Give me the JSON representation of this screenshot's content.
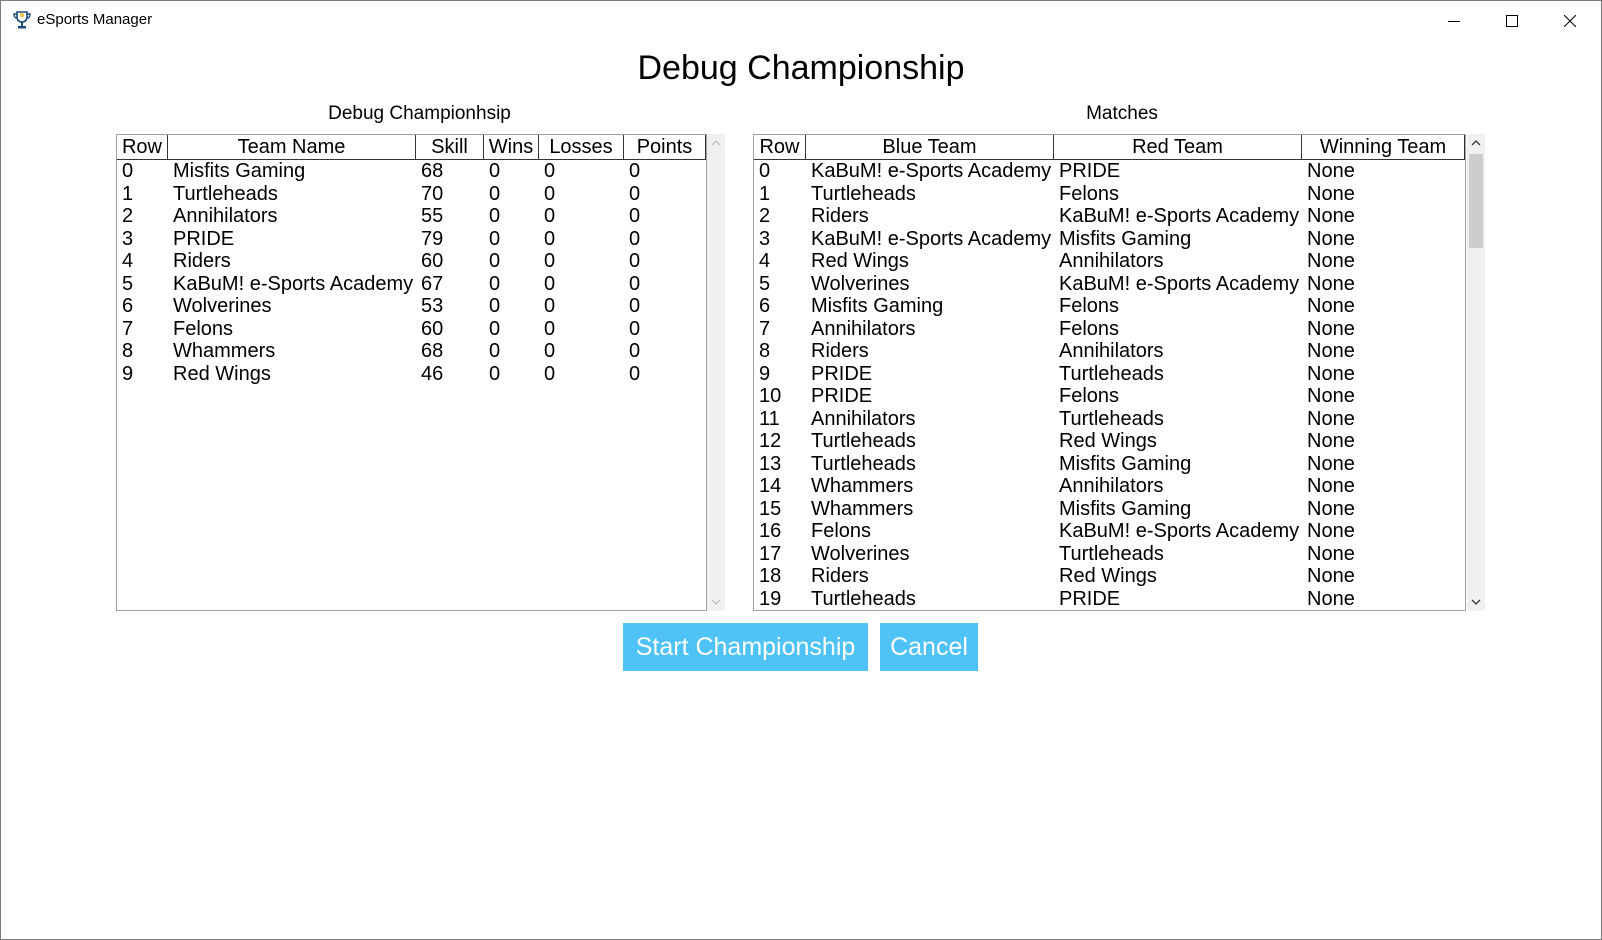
{
  "window": {
    "title": "eSports Manager",
    "icon": "trophy-icon"
  },
  "page": {
    "heading": "Debug Championship"
  },
  "standings": {
    "caption": "Debug Championhsip",
    "columns": [
      "Row",
      "Team Name",
      "Skill",
      "Wins",
      "Losses",
      "Points"
    ],
    "rows": [
      [
        "0",
        "Misfits Gaming",
        "68",
        "0",
        "0",
        "0"
      ],
      [
        "1",
        "Turtleheads",
        "70",
        "0",
        "0",
        "0"
      ],
      [
        "2",
        "Annihilators",
        "55",
        "0",
        "0",
        "0"
      ],
      [
        "3",
        "PRIDE",
        "79",
        "0",
        "0",
        "0"
      ],
      [
        "4",
        "Riders",
        "60",
        "0",
        "0",
        "0"
      ],
      [
        "5",
        "KaBuM! e-Sports Academy",
        "67",
        "0",
        "0",
        "0"
      ],
      [
        "6",
        "Wolverines",
        "53",
        "0",
        "0",
        "0"
      ],
      [
        "7",
        "Felons",
        "60",
        "0",
        "0",
        "0"
      ],
      [
        "8",
        "Whammers",
        "68",
        "0",
        "0",
        "0"
      ],
      [
        "9",
        "Red Wings",
        "46",
        "0",
        "0",
        "0"
      ]
    ]
  },
  "matches": {
    "caption": "Matches",
    "columns": [
      "Row",
      "Blue Team",
      "Red Team",
      "Winning Team"
    ],
    "rows": [
      [
        "0",
        "KaBuM! e-Sports Academy",
        "PRIDE",
        "None"
      ],
      [
        "1",
        "Turtleheads",
        "Felons",
        "None"
      ],
      [
        "2",
        "Riders",
        "KaBuM! e-Sports Academy",
        "None"
      ],
      [
        "3",
        "KaBuM! e-Sports Academy",
        "Misfits Gaming",
        "None"
      ],
      [
        "4",
        "Red Wings",
        "Annihilators",
        "None"
      ],
      [
        "5",
        "Wolverines",
        "KaBuM! e-Sports Academy",
        "None"
      ],
      [
        "6",
        "Misfits Gaming",
        "Felons",
        "None"
      ],
      [
        "7",
        "Annihilators",
        "Felons",
        "None"
      ],
      [
        "8",
        "Riders",
        "Annihilators",
        "None"
      ],
      [
        "9",
        "PRIDE",
        "Turtleheads",
        "None"
      ],
      [
        "10",
        "PRIDE",
        "Felons",
        "None"
      ],
      [
        "11",
        "Annihilators",
        "Turtleheads",
        "None"
      ],
      [
        "12",
        "Turtleheads",
        "Red Wings",
        "None"
      ],
      [
        "13",
        "Turtleheads",
        "Misfits Gaming",
        "None"
      ],
      [
        "14",
        "Whammers",
        "Annihilators",
        "None"
      ],
      [
        "15",
        "Whammers",
        "Misfits Gaming",
        "None"
      ],
      [
        "16",
        "Felons",
        "KaBuM! e-Sports Academy",
        "None"
      ],
      [
        "17",
        "Wolverines",
        "Turtleheads",
        "None"
      ],
      [
        "18",
        "Riders",
        "Red Wings",
        "None"
      ],
      [
        "19",
        "Turtleheads",
        "PRIDE",
        "None"
      ]
    ]
  },
  "buttons": {
    "start_label": "Start Championship",
    "cancel_label": "Cancel"
  },
  "colors": {
    "button_bg": "#4fc3f7",
    "button_text": "#ffffff"
  }
}
